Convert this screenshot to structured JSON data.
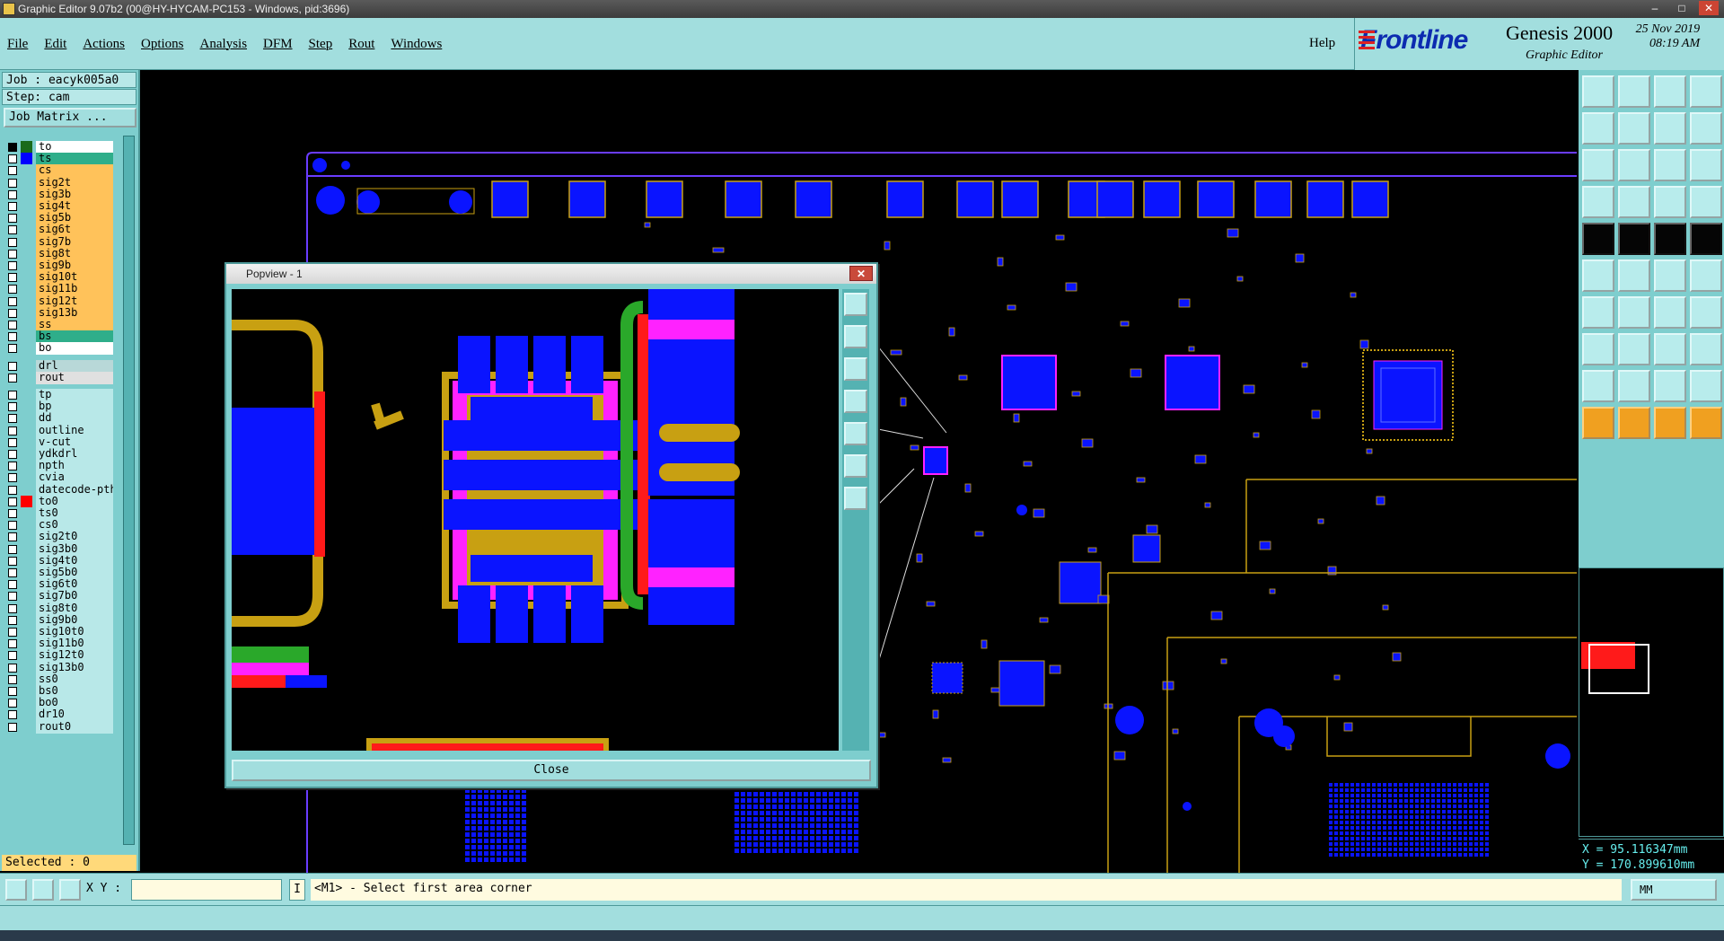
{
  "window": {
    "title": "Graphic Editor 9.07b2 (00@HY-HYCAM-PC153 - Windows, pid:3696)",
    "min": "–",
    "max": "□",
    "close": "✕"
  },
  "menu": {
    "items": [
      "File",
      "Edit",
      "Actions",
      "Options",
      "Analysis",
      "DFM",
      "Step",
      "Rout",
      "Windows"
    ],
    "help": "Help"
  },
  "brand": {
    "logo": "Frontline",
    "product": "Genesis 2000",
    "subtitle": "Graphic Editor",
    "date": "25 Nov 2019",
    "time": "08:19 AM"
  },
  "job": {
    "job_label": "Job : eacyk005a0",
    "step_label": "Step: cam",
    "matrix_button": "Job Matrix ..."
  },
  "layers": [
    {
      "name": "to",
      "bg": "#ffffff",
      "color": "#1a6a1a",
      "sel": true
    },
    {
      "name": "ts",
      "bg": "#2fae8a",
      "color": "#0000ff"
    },
    {
      "name": "cs",
      "bg": "#ffc25a",
      "color": ""
    },
    {
      "name": "sig2t",
      "bg": "#ffc25a",
      "color": ""
    },
    {
      "name": "sig3b",
      "bg": "#ffc25a",
      "color": ""
    },
    {
      "name": "sig4t",
      "bg": "#ffc25a",
      "color": ""
    },
    {
      "name": "sig5b",
      "bg": "#ffc25a",
      "color": ""
    },
    {
      "name": "sig6t",
      "bg": "#ffc25a",
      "color": ""
    },
    {
      "name": "sig7b",
      "bg": "#ffc25a",
      "color": ""
    },
    {
      "name": "sig8t",
      "bg": "#ffc25a",
      "color": ""
    },
    {
      "name": "sig9b",
      "bg": "#ffc25a",
      "color": ""
    },
    {
      "name": "sig10t",
      "bg": "#ffc25a",
      "color": ""
    },
    {
      "name": "sig11b",
      "bg": "#ffc25a",
      "color": ""
    },
    {
      "name": "sig12t",
      "bg": "#ffc25a",
      "color": ""
    },
    {
      "name": "sig13b",
      "bg": "#ffc25a",
      "color": ""
    },
    {
      "name": "ss",
      "bg": "#ffc25a",
      "color": ""
    },
    {
      "name": "bs",
      "bg": "#2fae8a",
      "color": ""
    },
    {
      "name": "bo",
      "bg": "#ffffff",
      "color": ""
    },
    {
      "name": "drl",
      "bg": "#b8d8d8",
      "color": "",
      "gap": true
    },
    {
      "name": "rout",
      "bg": "#e0e0e0",
      "color": ""
    },
    {
      "name": "tp",
      "bg": "#b8e8e8",
      "color": "",
      "gap": true
    },
    {
      "name": "bp",
      "bg": "#b8e8e8",
      "color": ""
    },
    {
      "name": "dd",
      "bg": "#b8e8e8",
      "color": ""
    },
    {
      "name": "outline",
      "bg": "#b8e8e8",
      "color": ""
    },
    {
      "name": "v-cut",
      "bg": "#b8e8e8",
      "color": ""
    },
    {
      "name": "ydkdrl",
      "bg": "#b8e8e8",
      "color": ""
    },
    {
      "name": "npth",
      "bg": "#b8e8e8",
      "color": ""
    },
    {
      "name": "cvia",
      "bg": "#b8e8e8",
      "color": ""
    },
    {
      "name": "datecode-pth",
      "bg": "#b8e8e8",
      "color": ""
    },
    {
      "name": "to0",
      "bg": "#b8e8e8",
      "color": "#ff0000"
    },
    {
      "name": "ts0",
      "bg": "#b8e8e8",
      "color": ""
    },
    {
      "name": "cs0",
      "bg": "#b8e8e8",
      "color": ""
    },
    {
      "name": "sig2t0",
      "bg": "#b8e8e8",
      "color": ""
    },
    {
      "name": "sig3b0",
      "bg": "#b8e8e8",
      "color": ""
    },
    {
      "name": "sig4t0",
      "bg": "#b8e8e8",
      "color": ""
    },
    {
      "name": "sig5b0",
      "bg": "#b8e8e8",
      "color": ""
    },
    {
      "name": "sig6t0",
      "bg": "#b8e8e8",
      "color": ""
    },
    {
      "name": "sig7b0",
      "bg": "#b8e8e8",
      "color": ""
    },
    {
      "name": "sig8t0",
      "bg": "#b8e8e8",
      "color": ""
    },
    {
      "name": "sig9b0",
      "bg": "#b8e8e8",
      "color": ""
    },
    {
      "name": "sig10t0",
      "bg": "#b8e8e8",
      "color": ""
    },
    {
      "name": "sig11b0",
      "bg": "#b8e8e8",
      "color": ""
    },
    {
      "name": "sig12t0",
      "bg": "#b8e8e8",
      "color": ""
    },
    {
      "name": "sig13b0",
      "bg": "#b8e8e8",
      "color": ""
    },
    {
      "name": "ss0",
      "bg": "#b8e8e8",
      "color": ""
    },
    {
      "name": "bs0",
      "bg": "#b8e8e8",
      "color": ""
    },
    {
      "name": "bo0",
      "bg": "#b8e8e8",
      "color": ""
    },
    {
      "name": "dr10",
      "bg": "#b8e8e8",
      "color": ""
    },
    {
      "name": "rout0",
      "bg": "#b8e8e8",
      "color": ""
    }
  ],
  "selected": "Selected : 0",
  "popview": {
    "title": "Popview - 1",
    "close_label": "Close"
  },
  "coords": {
    "x": "X = 95.116347mm",
    "y": "Y = 170.899610mm"
  },
  "status": {
    "xy_label": "X Y :",
    "xy_value": "",
    "prompt": "<M1> - Select first area corner",
    "units": "MM"
  },
  "colors": {
    "pad": "#0a14ff",
    "trace": "#c8a012",
    "highlight": "#ff22ff",
    "outline": "#6a3cff",
    "red": "#ff1a1a",
    "green": "#2aa82a"
  }
}
